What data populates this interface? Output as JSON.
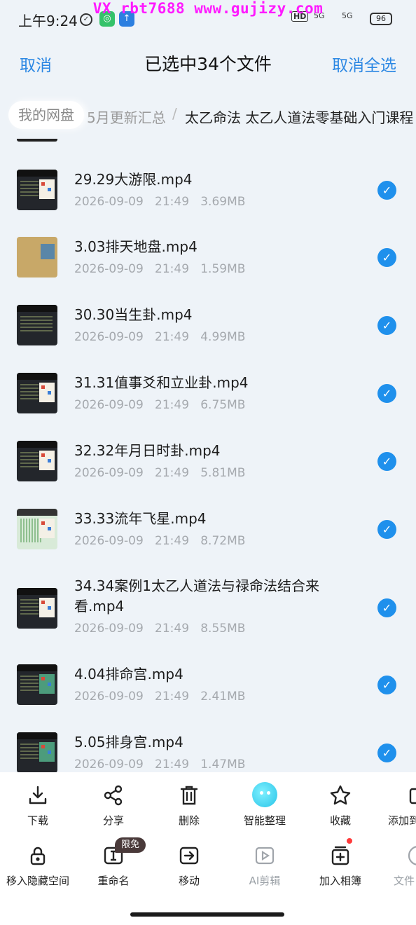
{
  "status_bar": {
    "time": "上午9:24",
    "watermark": "VX rbt7688   www.gujizy.com",
    "hd_label": "HD",
    "network_1": "5G",
    "network_2": "5G",
    "battery": "96"
  },
  "header": {
    "cancel_label": "取消",
    "title": "已选中34个文件",
    "deselect_all_label": "取消全选"
  },
  "breadcrumb": {
    "root": "我的网盘",
    "middle": "5月更新汇总",
    "separator": "/",
    "current": "太乙命法 太乙人道法零基础入门课程"
  },
  "files": [
    {
      "name": "29.29大游限.mp4",
      "date": "2026-09-09",
      "time": "21:49",
      "size": "3.69MB",
      "selected": true
    },
    {
      "name": "3.03排天地盘.mp4",
      "date": "2026-09-09",
      "time": "21:49",
      "size": "1.59MB",
      "selected": true
    },
    {
      "name": "30.30当生卦.mp4",
      "date": "2026-09-09",
      "time": "21:49",
      "size": "4.99MB",
      "selected": true
    },
    {
      "name": "31.31值事爻和立业卦.mp4",
      "date": "2026-09-09",
      "time": "21:49",
      "size": "6.75MB",
      "selected": true
    },
    {
      "name": "32.32年月日时卦.mp4",
      "date": "2026-09-09",
      "time": "21:49",
      "size": "5.81MB",
      "selected": true
    },
    {
      "name": "33.33流年飞星.mp4",
      "date": "2026-09-09",
      "time": "21:49",
      "size": "8.72MB",
      "selected": true
    },
    {
      "name": "34.34案例1太乙人道法与禄命法结合来看.mp4",
      "date": "2026-09-09",
      "time": "21:49",
      "size": "8.55MB",
      "selected": true
    },
    {
      "name": "4.04排命宫.mp4",
      "date": "2026-09-09",
      "time": "21:49",
      "size": "2.41MB",
      "selected": true
    },
    {
      "name": "5.05排身宫.mp4",
      "date": "2026-09-09",
      "time": "21:49",
      "size": "1.47MB",
      "selected": true
    }
  ],
  "toolbar": {
    "row1": [
      {
        "label": "下载",
        "icon": "download-icon"
      },
      {
        "label": "分享",
        "icon": "share-icon"
      },
      {
        "label": "删除",
        "icon": "trash-icon"
      },
      {
        "label": "智能整理",
        "icon": "ai-organize-icon"
      },
      {
        "label": "收藏",
        "icon": "star-icon"
      },
      {
        "label": "添加到",
        "icon": "add-to-icon"
      }
    ],
    "row2": [
      {
        "label": "移入隐藏空间",
        "icon": "lock-icon"
      },
      {
        "label": "重命名",
        "icon": "rename-icon"
      },
      {
        "label": "移动",
        "icon": "move-icon"
      },
      {
        "label": "AI剪辑",
        "icon": "ai-edit-icon"
      },
      {
        "label": "加入相簿",
        "icon": "album-add-icon"
      },
      {
        "label": "文件",
        "icon": "info-icon"
      }
    ],
    "free_badge": "限免"
  },
  "colors": {
    "accent": "#2b87e3",
    "check": "#1f90ec",
    "background": "#eef3f8"
  }
}
